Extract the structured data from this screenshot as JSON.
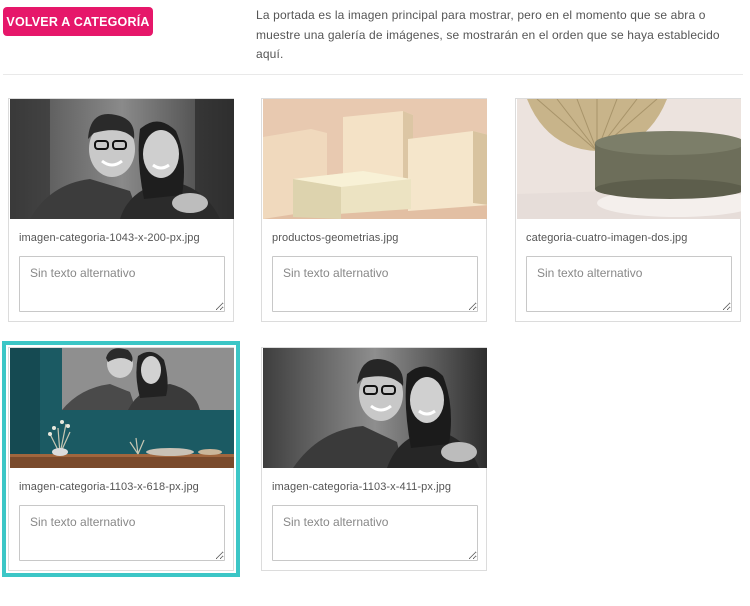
{
  "header": {
    "back_button_label": "VOLVER A CATEGORÍA",
    "intro_text": "La portada es la imagen principal para mostrar, pero en el momento que se abra o muestre una galería de imágenes, se mostrarán en el orden que se haya establecido aquí."
  },
  "gallery": {
    "images": [
      {
        "filename": "imagen-categoria-1043-x-200-px.jpg",
        "alt_placeholder": "Sin texto alternativo",
        "alt_value": "",
        "selected": false,
        "thumbnail": "couple-portrait-bw"
      },
      {
        "filename": "productos-geometrias.jpg",
        "alt_placeholder": "Sin texto alternativo",
        "alt_value": "",
        "selected": false,
        "thumbnail": "beige-geometric-blocks"
      },
      {
        "filename": "categoria-cuatro-imagen-dos.jpg",
        "alt_placeholder": "Sin texto alternativo",
        "alt_value": "",
        "selected": false,
        "thumbnail": "olive-podium-paper-fan"
      },
      {
        "filename": "imagen-categoria-1103-x-618-px.jpg",
        "alt_placeholder": "Sin texto alternativo",
        "alt_value": "",
        "selected": true,
        "thumbnail": "couple-canvas-teal-room"
      },
      {
        "filename": "imagen-categoria-1103-x-411-px.jpg",
        "alt_placeholder": "Sin texto alternativo",
        "alt_value": "",
        "selected": false,
        "thumbnail": "couple-portrait-bw"
      }
    ]
  },
  "colors": {
    "accent": "#e6176a",
    "selected_outline": "#3cc6c6",
    "border": "#dcdcdc"
  }
}
